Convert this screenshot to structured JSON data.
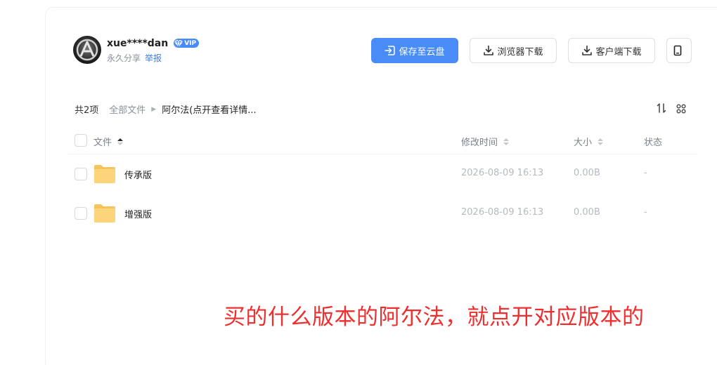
{
  "user": {
    "name": "xue****dan",
    "vip_label": "VIP",
    "share_type": "永久分享",
    "report_label": "举报"
  },
  "actions": {
    "save": "保存至云盘",
    "browser_download": "浏览器下载",
    "client_download": "客户端下载"
  },
  "breadcrumb": {
    "count": "共2项",
    "root": "全部文件",
    "current": "阿尔法(点开查看详情..."
  },
  "table": {
    "headers": {
      "file": "文件",
      "modified": "修改时间",
      "size": "大小",
      "status": "状态"
    },
    "rows": [
      {
        "name": "传承版",
        "modified": "2026-08-09 16:13",
        "size": "0.00B",
        "status": "-"
      },
      {
        "name": "增强版",
        "modified": "2026-08-09 16:13",
        "size": "0.00B",
        "status": "-"
      }
    ]
  },
  "annotation": "买的什么版本的阿尔法，就点开对应版本的",
  "colors": {
    "accent": "#4a8cf7",
    "annotation": "#ee2f2f",
    "folder": "#fcd47c"
  }
}
